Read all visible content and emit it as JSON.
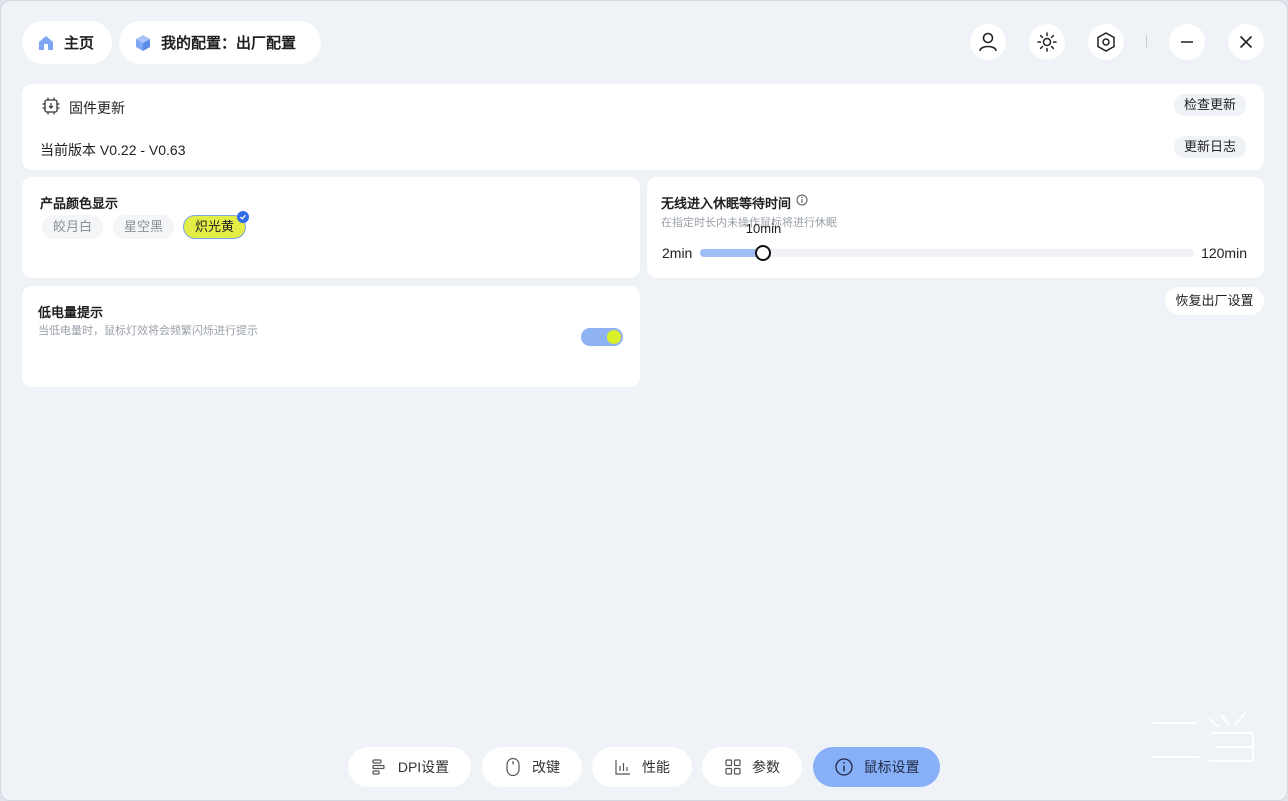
{
  "topbar": {
    "home_label": "主页",
    "config_label": "我的配置：出厂配置"
  },
  "firmware": {
    "title": "固件更新",
    "check_update": "检查更新",
    "version_text": "当前版本 V0.22 - V0.63",
    "changelog": "更新日志"
  },
  "product_color": {
    "title": "产品颜色显示",
    "options": [
      "皎月白",
      "星空黑",
      "炽光黄"
    ],
    "selected": "炽光黄"
  },
  "sleep": {
    "title": "无线进入休眠等待时间",
    "desc": "在指定时长内未操作鼠标将进行休眠",
    "min_label": "2min",
    "max_label": "120min",
    "current_label": "10min",
    "value_min": 2,
    "value_max": 120,
    "value": 10
  },
  "low_battery": {
    "title": "低电量提示",
    "desc": "当低电量时，鼠标灯效将会频繁闪烁进行提示",
    "enabled": true
  },
  "reset": {
    "label": "恢复出厂设置"
  },
  "bottom_nav": [
    {
      "label": "DPI设置",
      "icon": "dpi-icon"
    },
    {
      "label": "改键",
      "icon": "mouse-icon"
    },
    {
      "label": "性能",
      "icon": "performance-icon"
    },
    {
      "label": "参数",
      "icon": "grid-icon"
    },
    {
      "label": "鼠标设置",
      "icon": "info-icon"
    }
  ],
  "colors": {
    "background": "#eff2f6",
    "accent": "#88b0f8",
    "highlight": "#e2ee46",
    "check": "#2f6bea"
  }
}
